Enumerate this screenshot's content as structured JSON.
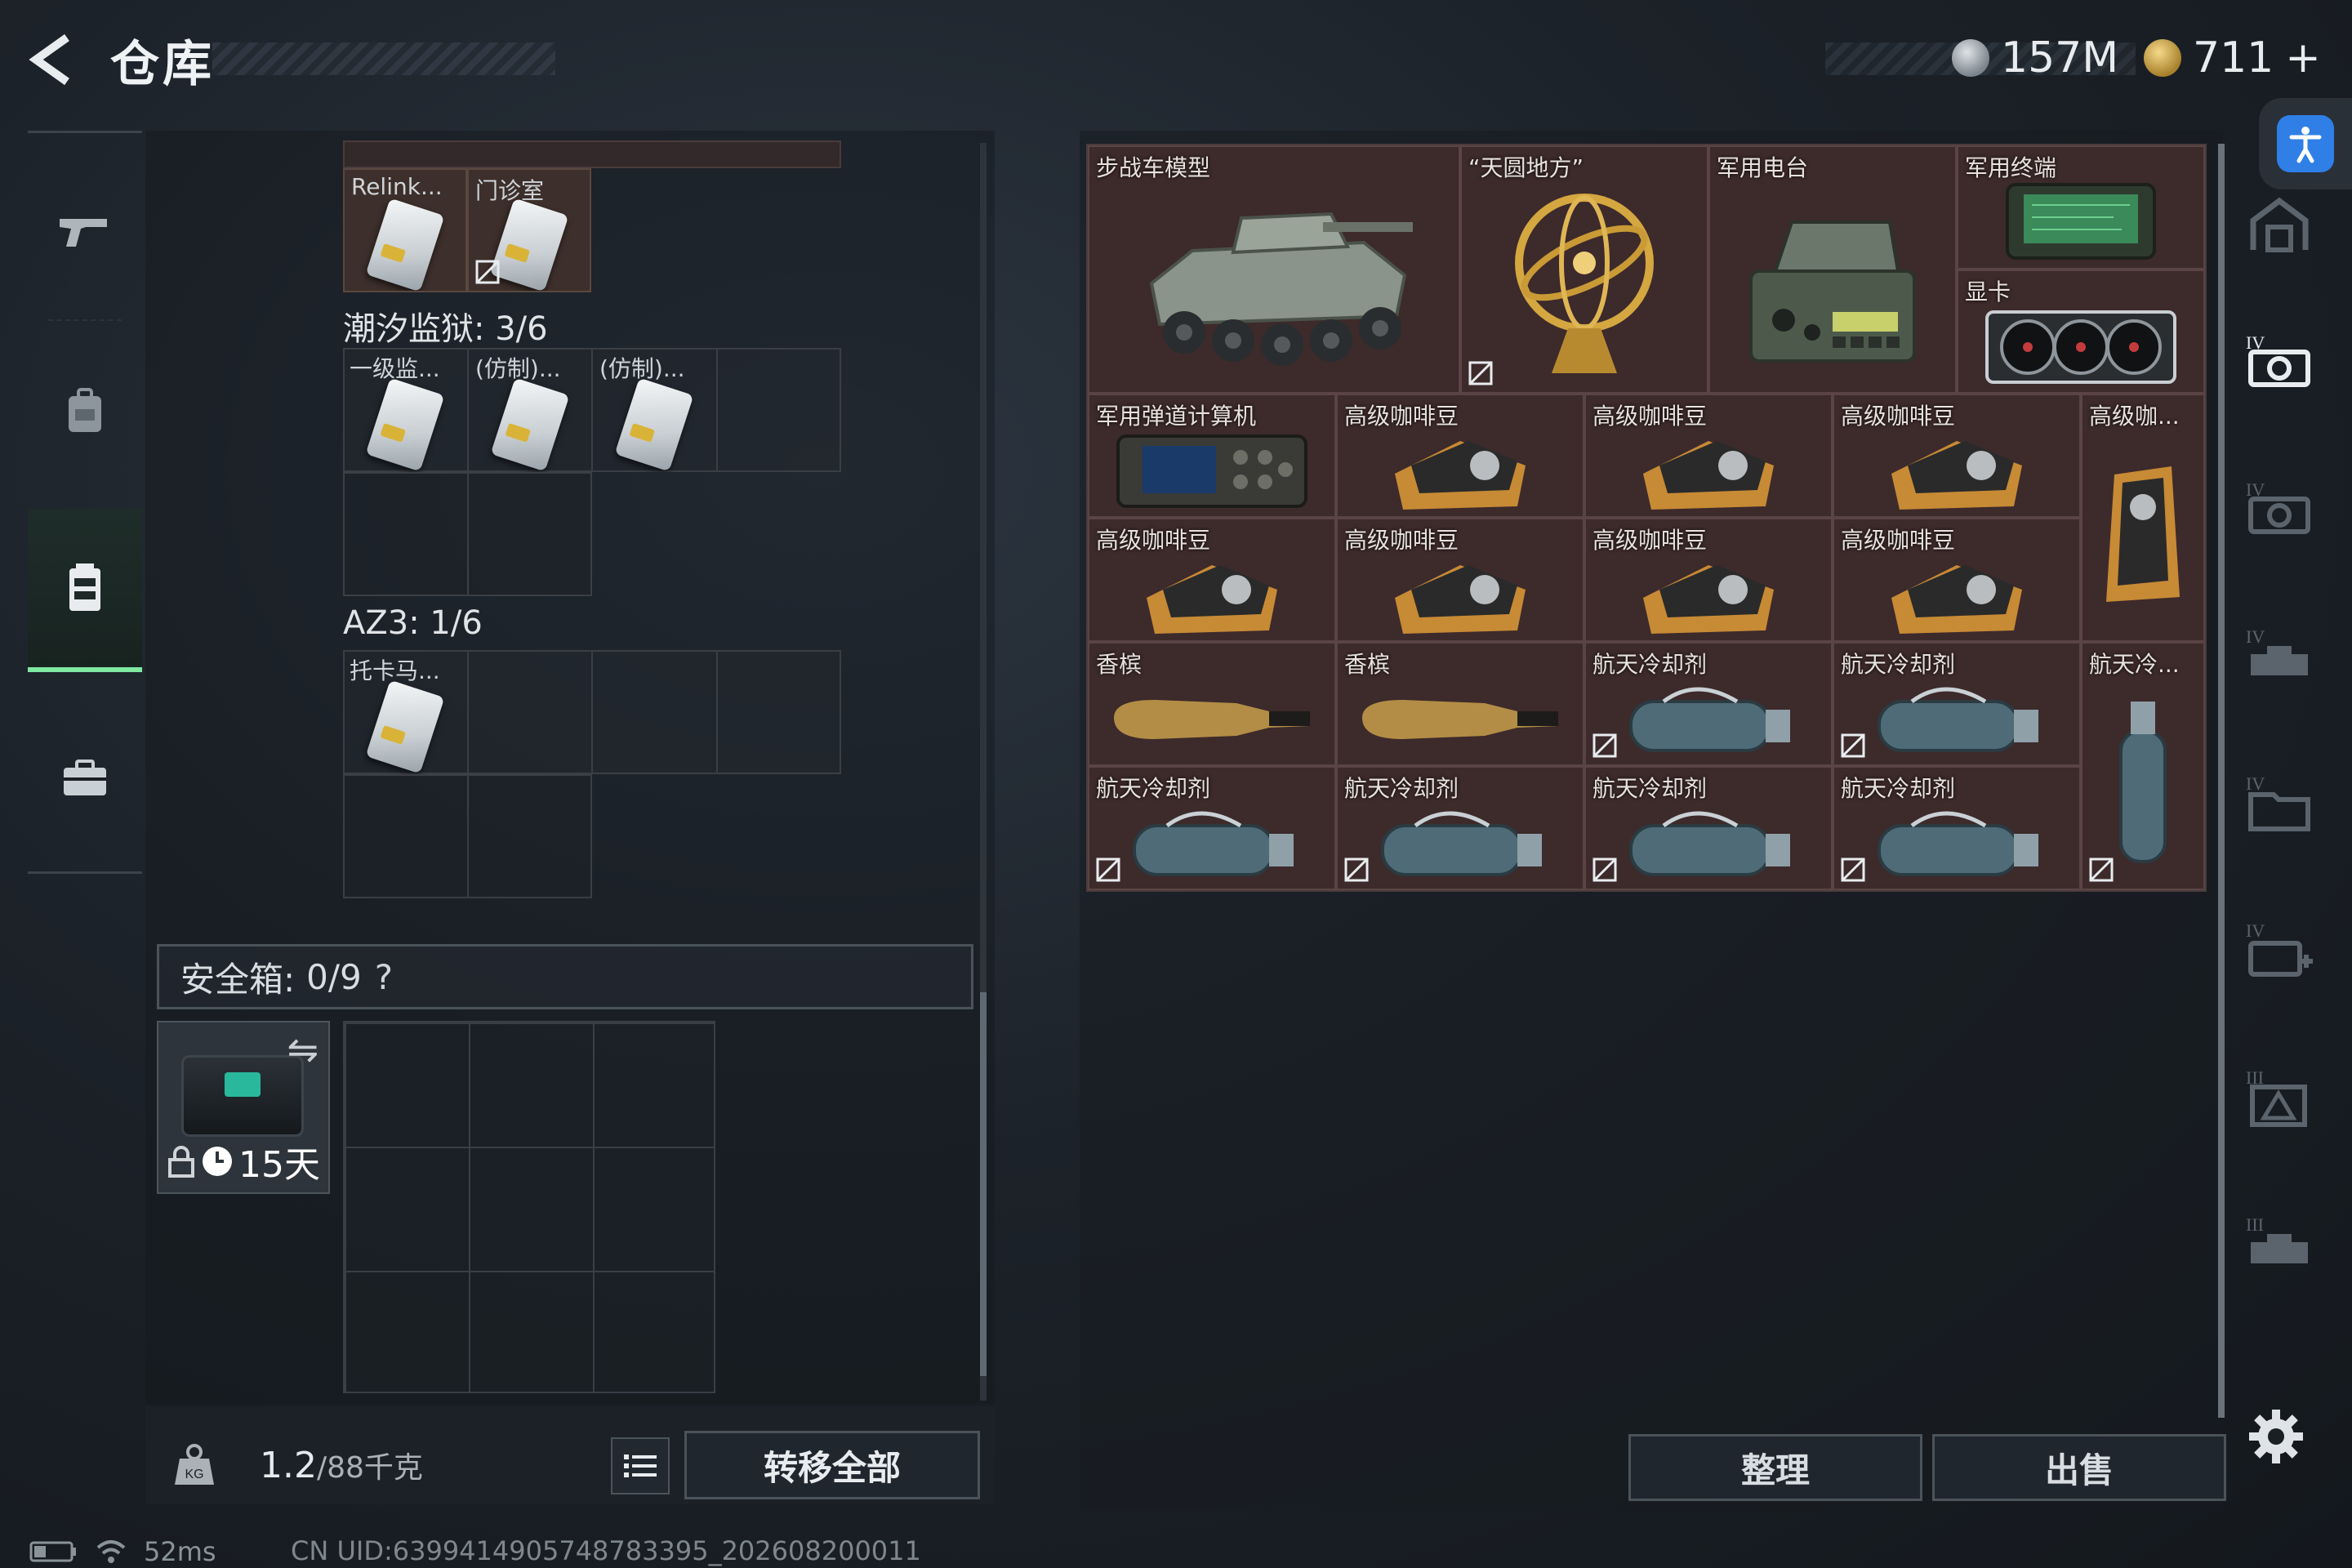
{
  "header": {
    "title": "仓库",
    "currency_silver": "157M",
    "currency_gold": "711",
    "currency_gold_add": "+"
  },
  "left_nav": {
    "items": [
      {
        "icon": "gun-icon"
      },
      {
        "icon": "backpack-icon"
      },
      {
        "icon": "chest-rig-icon"
      },
      {
        "icon": "briefcase-icon"
      }
    ]
  },
  "left_storage": {
    "top_row_items": [
      {
        "name": "Relink..."
      },
      {
        "name": "门诊室"
      }
    ],
    "sections": [
      {
        "label": "潮汐监狱: 3/6",
        "items": [
          {
            "name": "一级监..."
          },
          {
            "name": "(仿制)..."
          },
          {
            "name": "(仿制)..."
          }
        ]
      },
      {
        "label": "AZ3: 1/6",
        "items": [
          {
            "name": "托卡马..."
          }
        ]
      }
    ]
  },
  "safe_box": {
    "label": "安全箱:",
    "count": "0/9",
    "help": "?",
    "days": "15天"
  },
  "left_bottom": {
    "weight_value": "1.2",
    "weight_capacity": "/88千克",
    "transfer_all": "转移全部"
  },
  "right_storage": {
    "items": [
      {
        "name": "步战车模型",
        "art": "ifv-model"
      },
      {
        "name": "“天圆地方”",
        "art": "armillary"
      },
      {
        "name": "军用电台",
        "art": "radio"
      },
      {
        "name": "军用终端",
        "art": "terminal"
      },
      {
        "name": "显卡",
        "art": "gpu"
      },
      {
        "name": "军用弹道计算机",
        "art": "ballistic-computer"
      },
      {
        "name": "高级咖啡豆",
        "art": "coffee"
      },
      {
        "name": "高级咖啡豆",
        "art": "coffee"
      },
      {
        "name": "高级咖啡豆",
        "art": "coffee"
      },
      {
        "name": "高级咖...",
        "art": "coffee-bag"
      },
      {
        "name": "高级咖啡豆",
        "art": "coffee"
      },
      {
        "name": "高级咖啡豆",
        "art": "coffee"
      },
      {
        "name": "高级咖啡豆",
        "art": "coffee"
      },
      {
        "name": "高级咖啡豆",
        "art": "coffee"
      },
      {
        "name": "香槟",
        "art": "champagne"
      },
      {
        "name": "香槟",
        "art": "champagne"
      },
      {
        "name": "航天冷却剂",
        "art": "coolant"
      },
      {
        "name": "航天冷却剂",
        "art": "coolant"
      },
      {
        "name": "航天冷...",
        "art": "coolant-vertical"
      },
      {
        "name": "航天冷却剂",
        "art": "coolant"
      },
      {
        "name": "航天冷却剂",
        "art": "coolant"
      },
      {
        "name": "航天冷却剂",
        "art": "coolant"
      },
      {
        "name": "航天冷却剂",
        "art": "coolant"
      }
    ],
    "sort_label": "整理",
    "sell_label": "出售"
  },
  "right_tabs": [
    {
      "icon": "home-stash-icon"
    },
    {
      "icon": "tier4-camera-icon",
      "tier": "IV"
    },
    {
      "icon": "tier4-camera-icon",
      "tier": "IV"
    },
    {
      "icon": "tier4-vehicle-icon",
      "tier": "IV"
    },
    {
      "icon": "tier4-folder-icon",
      "tier": "IV"
    },
    {
      "icon": "tier4-medical-icon",
      "tier": "IV"
    },
    {
      "icon": "tier3-warning-icon",
      "tier": "III"
    },
    {
      "icon": "tier3-vehicle-icon",
      "tier": "III"
    }
  ],
  "status": {
    "ping": "52ms",
    "uid": "CN UID:6399414905748783395_202608200011"
  },
  "colors": {
    "accent_green": "#7fe8a2",
    "accessibility_blue": "#2f7fe6",
    "item_maroon": "#3d2a2b"
  }
}
